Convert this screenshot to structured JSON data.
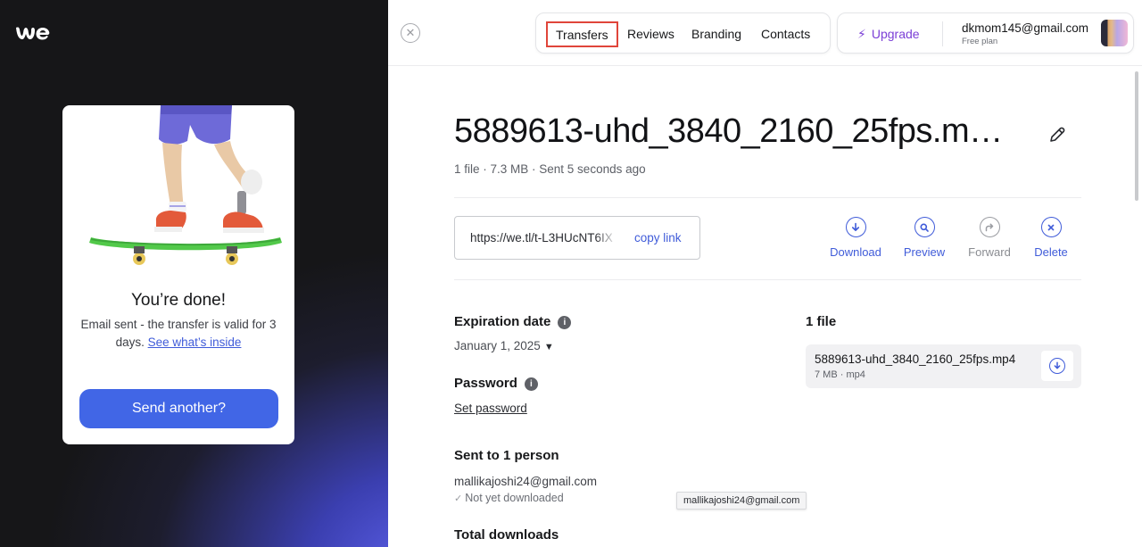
{
  "confirmation": {
    "title": "You’re done!",
    "message_prefix": "Email sent - the transfer is valid for 3 days.",
    "message_link": "See what’s inside",
    "send_another": "Send another?"
  },
  "nav": {
    "items": [
      {
        "label": "Transfers",
        "active": true
      },
      {
        "label": "Reviews"
      },
      {
        "label": "Branding"
      },
      {
        "label": "Contacts"
      }
    ]
  },
  "account": {
    "upgrade_label": "Upgrade",
    "email": "dkmom145@gmail.com",
    "plan": "Free plan"
  },
  "transfer": {
    "title": "5889613-uhd_3840_2160_25fps.m…",
    "meta": "1 file · 7.3 MB · Sent 5 seconds ago",
    "link_url": "https://we.tl/t-L3HUcNT6IX",
    "copy_link": "copy link"
  },
  "actions": [
    {
      "label": "Download",
      "icon": "download-icon",
      "enabled": true
    },
    {
      "label": "Preview",
      "icon": "preview-icon",
      "enabled": true
    },
    {
      "label": "Forward",
      "icon": "forward-icon",
      "enabled": false
    },
    {
      "label": "Delete",
      "icon": "delete-icon",
      "enabled": true
    }
  ],
  "details": {
    "expiration_heading": "Expiration date",
    "expiration_value": "January 1, 2025",
    "password_heading": "Password",
    "set_password": "Set password",
    "sent_to_heading": "Sent to 1 person",
    "recipient": "mallikajoshi24@gmail.com",
    "recipient_status": "Not yet downloaded",
    "total_downloads_heading": "Total downloads",
    "tooltip": "mallikajoshi24@gmail.com"
  },
  "files": {
    "heading": "1 file",
    "items": [
      {
        "name": "5889613-uhd_3840_2160_25fps.mp4",
        "meta": "7 MB · mp4"
      }
    ]
  },
  "colors": {
    "accent": "#3f5bd9",
    "send_button": "#4166e6",
    "upgrade": "#7b3fd6",
    "active_highlight": "#e0453a"
  }
}
